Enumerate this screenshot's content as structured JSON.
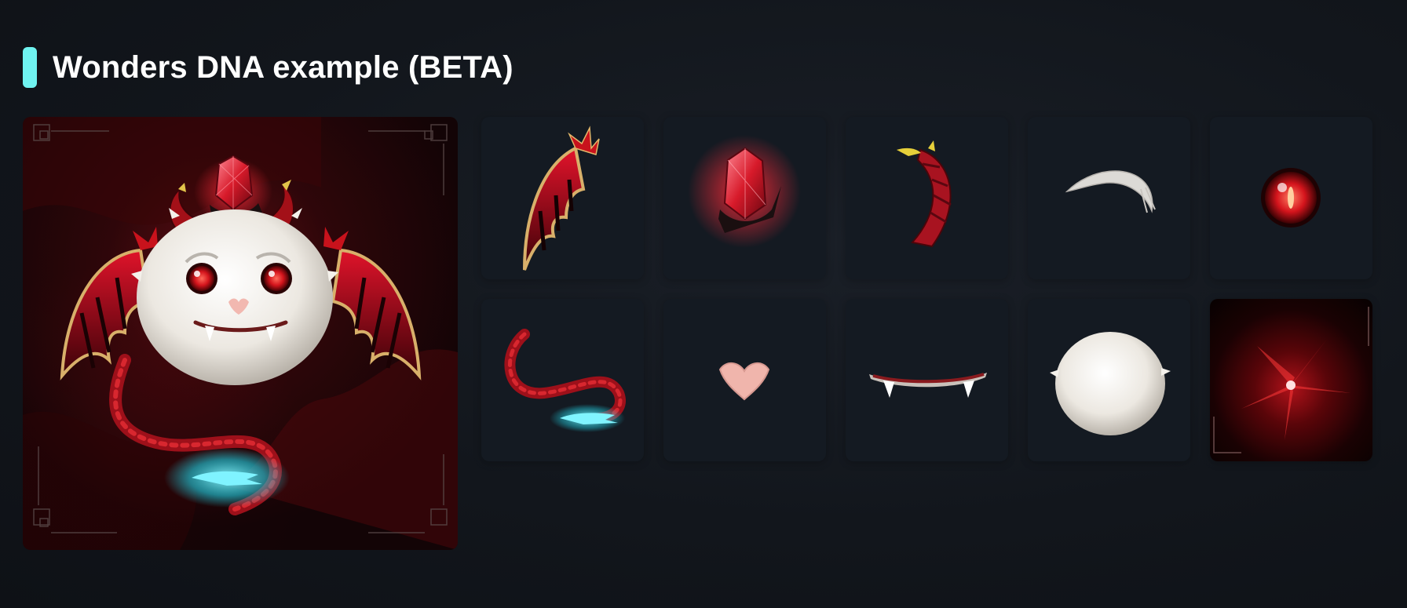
{
  "section": {
    "title": "Wonders DNA example (BETA)",
    "accent_color": "#6ff3f0"
  },
  "main_image": {
    "name": "wonder-character-preview"
  },
  "parts": [
    {
      "name": "wings-part"
    },
    {
      "name": "crystal-part"
    },
    {
      "name": "horn-part"
    },
    {
      "name": "eyebrow-part"
    },
    {
      "name": "eye-part"
    },
    {
      "name": "tail-part"
    },
    {
      "name": "nose-part"
    },
    {
      "name": "mouth-part"
    },
    {
      "name": "body-part"
    },
    {
      "name": "background-part"
    }
  ],
  "colors": {
    "page_background": "#12161c",
    "tile_background": "#141a22",
    "accent": "#6ff3f0",
    "crimson": "#c0121e",
    "fur_white": "#f1eee8",
    "glow_cyan": "#39e6f2"
  }
}
